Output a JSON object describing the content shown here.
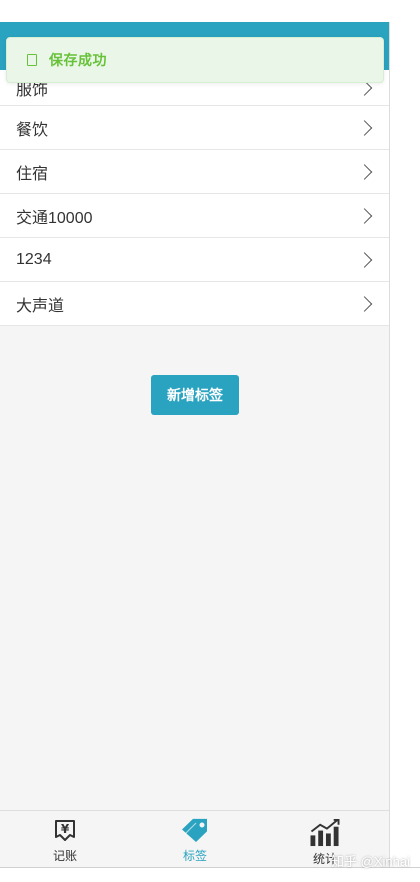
{
  "toast": {
    "message": "保存成功"
  },
  "tags": [
    {
      "label": "服饰"
    },
    {
      "label": "餐饮"
    },
    {
      "label": "住宿"
    },
    {
      "label": "交通10000"
    },
    {
      "label": "1234"
    },
    {
      "label": "大声道"
    }
  ],
  "actions": {
    "add_tag_label": "新增标签"
  },
  "tabbar": {
    "items": [
      {
        "label": "记账",
        "icon": "money-icon",
        "active": false
      },
      {
        "label": "标签",
        "icon": "tag-icon",
        "active": true
      },
      {
        "label": "统计",
        "icon": "chart-icon",
        "active": false
      }
    ]
  },
  "watermark": "知乎 @Xinhai",
  "colors": {
    "accent": "#2aa3c0",
    "success": "#67c23a",
    "background": "#f5f5f5"
  }
}
